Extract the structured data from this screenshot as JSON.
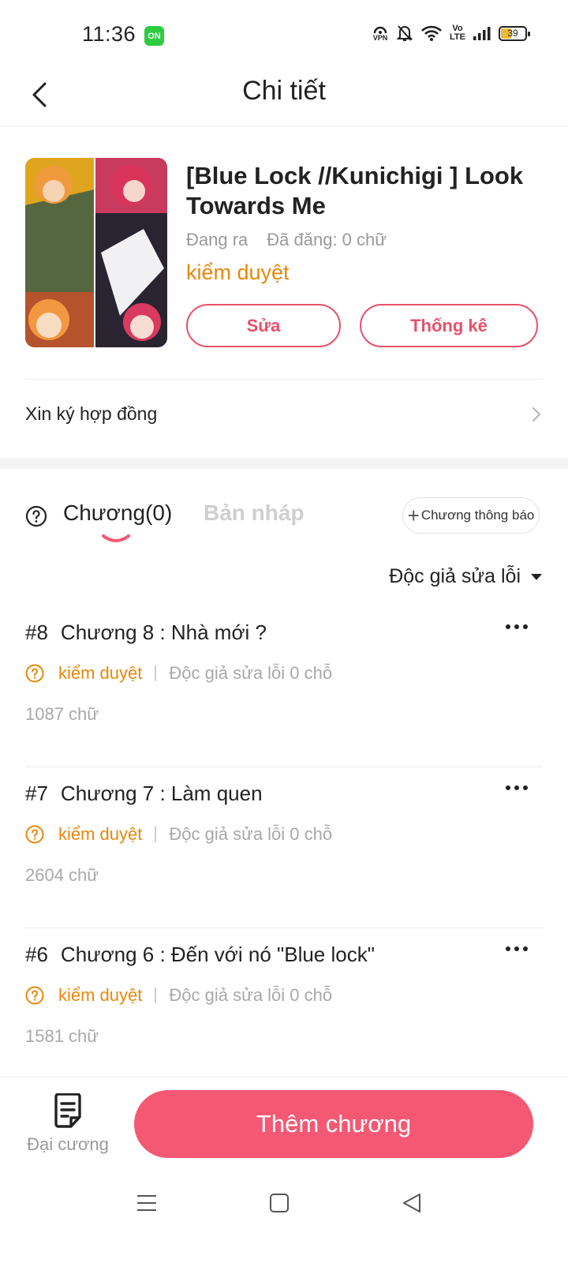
{
  "status_bar": {
    "time": "11:36",
    "app_badge": "ON",
    "vpn_label": "VPN",
    "volte_label": "Vo\nLTE",
    "battery": "39"
  },
  "header": {
    "title": "Chi tiết",
    "back_icon": "chevron-left-icon"
  },
  "book": {
    "title": "[Blue Lock //Kunichigi ] Look Towards Me",
    "state": "Đang ra",
    "posted": "Đã đăng: 0 chữ",
    "review_status": "kiểm duyệt",
    "edit_label": "Sửa",
    "stats_label": "Thống kê"
  },
  "contract": {
    "label": "Xin ký hợp đồng"
  },
  "tabs": {
    "chapters_label": "Chương(0)",
    "drafts_label": "Bản nháp",
    "notice_label": "Chương thông báo"
  },
  "filter": {
    "label": "Độc giả sửa lỗi"
  },
  "chapters": [
    {
      "num": "#8",
      "title": "Chương 8 : Nhà mới ?",
      "status": "kiểm duyệt",
      "fixes": "Độc giả sửa lỗi 0 chỗ",
      "words": "1087 chữ"
    },
    {
      "num": "#7",
      "title": "Chương 7 : Làm quen",
      "status": "kiểm duyệt",
      "fixes": "Độc giả sửa lỗi 0 chỗ",
      "words": "2604 chữ"
    },
    {
      "num": "#6",
      "title": "Chương 6 : Đến với nó \"Blue lock\"",
      "status": "kiểm duyệt",
      "fixes": "Độc giả sửa lỗi 0 chỗ",
      "words": "1581 chữ"
    }
  ],
  "bottom": {
    "outline_label": "Đại cương",
    "add_chapter_label": "Thêm chương"
  },
  "colors": {
    "accent": "#f55873",
    "accent_outline": "#e8506b",
    "status_orange": "#e8870c",
    "muted": "#a8a8a8"
  }
}
